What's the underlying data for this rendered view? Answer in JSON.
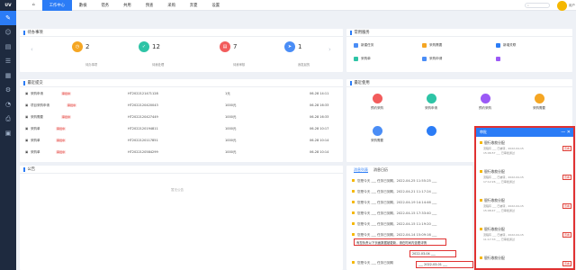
{
  "app": {
    "logo": "UV"
  },
  "topbar": {
    "menu": [
      "工作中心",
      "數檢",
      "错务",
      "共用",
      "预查",
      "采购",
      "奔夏",
      "设置"
    ],
    "active_menu": 0,
    "search_placeholder": "",
    "user": "用户"
  },
  "sidebar": {
    "icons": [
      "edit-icon",
      "user-icon",
      "document-icon",
      "list-icon",
      "report-icon",
      "settings-icon",
      "chart-icon",
      "print-icon",
      "archive-icon"
    ]
  },
  "todo": {
    "title": "待办事项",
    "stats": [
      {
        "num": "2",
        "label": "待办事项",
        "color": "#f5a623"
      },
      {
        "num": "12",
        "label": "待我处理",
        "color": "#2ec4a6"
      },
      {
        "num": "7",
        "label": "待我审核",
        "color": "#f25c5c"
      },
      {
        "num": "1",
        "label": "我发起的",
        "color": "#4a8df6"
      }
    ]
  },
  "quick": {
    "title": "常用服务",
    "items": [
      {
        "label": "新建任务",
        "color": "#4a8df6"
      },
      {
        "label": "采购需要",
        "color": "#f5a623"
      },
      {
        "label": "新增关联",
        "color": "#2b7cf6"
      },
      {
        "label": "采购单",
        "color": "#2ec4a6"
      },
      {
        "label": "采购申请",
        "color": "#4a8df6"
      },
      {
        "label": "",
        "color": "#9b59f6"
      }
    ]
  },
  "recent": {
    "title": "最近提交",
    "rows": [
      {
        "name": "采购申请",
        "tag": "",
        "code": "HT2022121471128",
        "amount": "1元",
        "date": "06-28 14:11"
      },
      {
        "name": "项目采购申请",
        "tag": "",
        "code": "HT2022120420043",
        "amount": "1000元",
        "date": "06-28 16:33"
      },
      {
        "name": "采购需要",
        "tag": "",
        "code": "HT2022120427449",
        "amount": "1000元",
        "date": "06-28 16:33"
      },
      {
        "name": "采购单",
        "tag": "",
        "code": "HT2022120194811",
        "amount": "1000元",
        "date": "06-28 10:17"
      },
      {
        "name": "采购单",
        "tag": "",
        "code": "HT2022120117851",
        "amount": "1000元",
        "date": "06-28 10:14"
      },
      {
        "name": "采购单",
        "tag": "",
        "code": "HT2022120584299",
        "amount": "1000元",
        "date": "06-28 10:14"
      }
    ]
  },
  "common": {
    "title": "最近使用",
    "items": [
      {
        "label": "预约采购",
        "color": "#f25c5c"
      },
      {
        "label": "采购申请",
        "color": "#2ec4a6"
      },
      {
        "label": "预约采购",
        "color": "#9b59f6"
      },
      {
        "label": "采购需要",
        "color": "#f5a623"
      },
      {
        "label": "采购需要",
        "color": "#4a8df6"
      },
      {
        "label": "",
        "color": "#2b7cf6"
      }
    ]
  },
  "notice": {
    "title": "公告",
    "empty": "暂无公告"
  },
  "messages": {
    "tabs": [
      "消息列表",
      "消息日历"
    ],
    "items": [
      "您是今天 ___ 任务已到期，2022-04-25 11:55:25 ___",
      "您是今天 ___ 任务已到期，2022-04-21 11:17:24 ___",
      "您是今天 ___ 任务已到期，2022-04-19 14:14:46 ___",
      "您是今天 ___ 任务已到期，2022-04-15 17:33:40 ___",
      "您是今天 ___ 任务已到期，2022-04-15 11:19:20 ___",
      "您是今天 ___ 任务已到期，2022-04-14 15:09:16 ___",
      "您是今天 ___ 任务已到期"
    ],
    "redbox1": "有您负责以下页面数据被更新，请在时间内查看详情",
    "redbox2": "2022-03-04 ___",
    "redbox3": "___ 2022-03-01 ___"
  },
  "notify": {
    "title": "审批",
    "cards": [
      {
        "title": "银行收款分配",
        "body1": "流程有 ___ 已被转，2022-04-15",
        "body2": "15:06:57 ___ 已审批通过",
        "btn": "查看"
      },
      {
        "title": "银行收款分配",
        "body1": "流程有 ___ 已被转，2022-04-15",
        "body2": "17:12:26 ___ 已审批通过",
        "btn": "查看"
      },
      {
        "title": "银行收款分配",
        "body1": "流程有 ___ 已被转，2022-04-15",
        "body2": "15:08:47 ___ 已审批通过",
        "btn": "查看"
      },
      {
        "title": "银行收款分配",
        "body1": "流程有 ___ 已被转，2022-04-15",
        "body2": "11:17:33 ___ 已审批通过",
        "btn": "查看"
      },
      {
        "title": "银行收款分配",
        "body1": "",
        "body2": "",
        "btn": "查看"
      }
    ]
  }
}
